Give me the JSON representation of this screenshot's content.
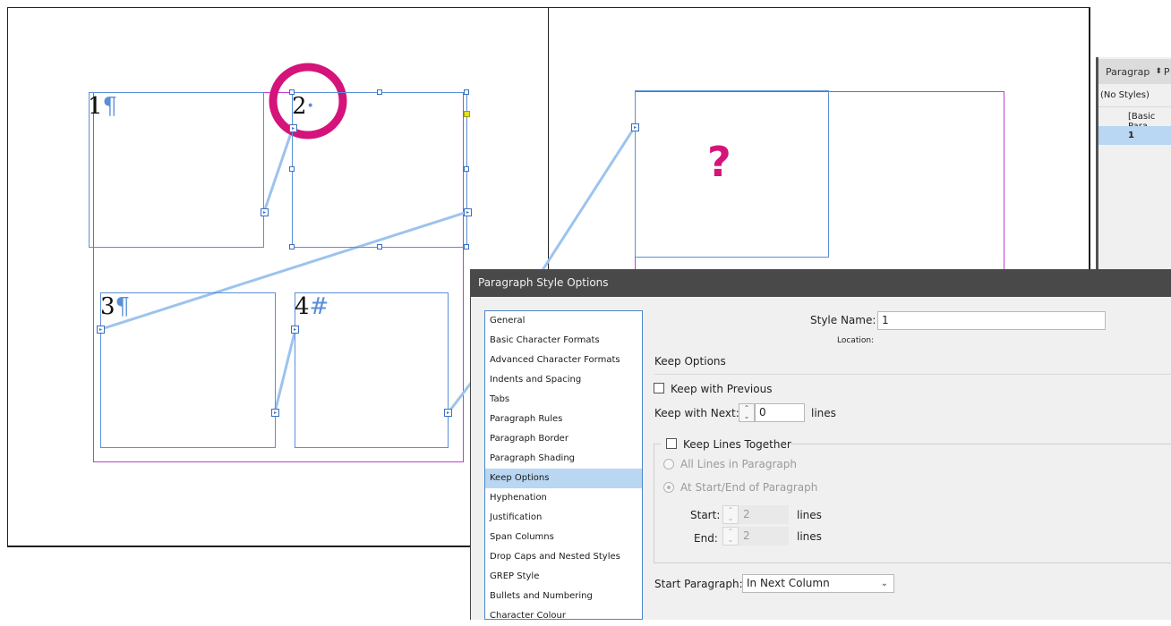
{
  "canvas": {
    "frames": [
      {
        "number": "1",
        "mark": "¶"
      },
      {
        "number": "2",
        "mark": "•"
      },
      {
        "number": "3",
        "mark": "¶"
      },
      {
        "number": "4",
        "mark": "#"
      }
    ],
    "question_mark": "?",
    "annotation_color": "#d4147a"
  },
  "paragraph_styles_panel": {
    "tab_label": "Paragrap",
    "tab_extra": "P",
    "rows": [
      "(No Styles)",
      "[Basic Para",
      "1"
    ]
  },
  "dialog": {
    "title": "Paragraph Style Options",
    "categories": [
      "General",
      "Basic Character Formats",
      "Advanced Character Formats",
      "Indents and Spacing",
      "Tabs",
      "Paragraph Rules",
      "Paragraph Border",
      "Paragraph Shading",
      "Keep Options",
      "Hyphenation",
      "Justification",
      "Span Columns",
      "Drop Caps and Nested Styles",
      "GREP Style",
      "Bullets and Numbering",
      "Character Colour"
    ],
    "selected_category": "Keep Options",
    "style_name_label": "Style Name:",
    "style_name_value": "1",
    "location_label": "Location:",
    "section_title": "Keep Options",
    "keep_with_previous": "Keep with Previous",
    "keep_with_next_label": "Keep with Next:",
    "keep_with_next_value": "0",
    "lines_unit": "lines",
    "keep_lines_together": "Keep Lines Together",
    "all_lines": "All Lines in Paragraph",
    "at_start_end": "At Start/End of Paragraph",
    "start_label": "Start:",
    "start_value": "2",
    "end_label": "End:",
    "end_value": "2",
    "start_paragraph_label": "Start Paragraph:",
    "start_paragraph_value": "In Next Column"
  },
  "colors": {
    "frame_blue": "#5a8fd8",
    "margin_purple": "#c33bd6",
    "thread_blue": "#9cc3ee",
    "selected_row": "#b9d6f3",
    "dialog_title_bg": "#494949"
  }
}
